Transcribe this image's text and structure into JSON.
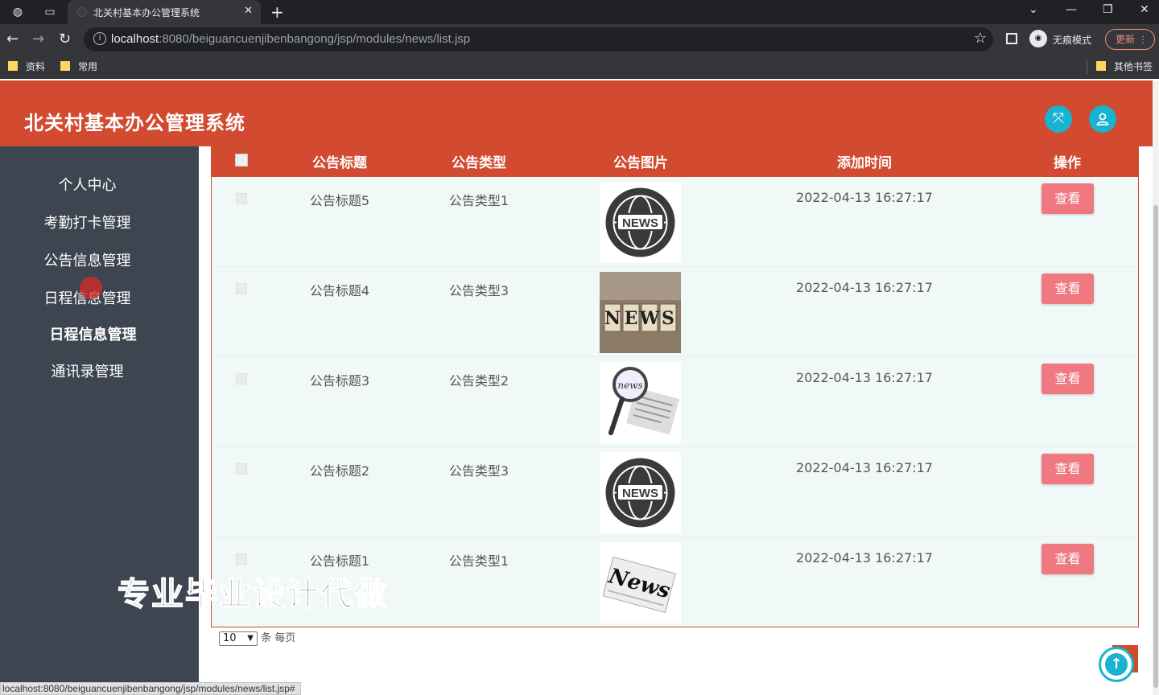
{
  "browser": {
    "tab_title": "北关村基本办公管理系统",
    "url_host": "localhost",
    "url_rest": ":8080/beiguancuenjibenbangong/jsp/modules/news/list.jsp",
    "incognito_label": "无痕模式",
    "update_label": "更新",
    "bookmarks": [
      "资料",
      "常用"
    ],
    "other_bookmarks": "其他书签",
    "status_url": "localhost:8080/beiguancuenjibenbangong/jsp/modules/news/list.jsp#"
  },
  "app": {
    "title": "北关村基本办公管理系统",
    "accent": "#d24a2f"
  },
  "sidebar": {
    "items": [
      "个人中心",
      "考勤打卡管理",
      "公告信息管理",
      "日程信息管理",
      "日程信息管理",
      "通讯录管理"
    ]
  },
  "table": {
    "columns": [
      "公告标题",
      "公告类型",
      "公告图片",
      "添加时间",
      "操作"
    ],
    "rows": [
      {
        "title": "公告标题5",
        "type": "公告类型1",
        "image": "news-globe",
        "time": "2022-04-13 16:27:17",
        "action": "查看"
      },
      {
        "title": "公告标题4",
        "type": "公告类型3",
        "image": "news-blocks",
        "time": "2022-04-13 16:27:17",
        "action": "查看"
      },
      {
        "title": "公告标题3",
        "type": "公告类型2",
        "image": "news-magnifier",
        "time": "2022-04-13 16:27:17",
        "action": "查看"
      },
      {
        "title": "公告标题2",
        "type": "公告类型3",
        "image": "news-globe",
        "time": "2022-04-13 16:27:17",
        "action": "查看"
      },
      {
        "title": "公告标题1",
        "type": "公告类型1",
        "image": "news-paper",
        "time": "2022-04-13 16:27:17",
        "action": "查看"
      }
    ]
  },
  "pager": {
    "page_size": "10",
    "suffix": "条 每页"
  },
  "watermark": "专业毕业设计代做"
}
